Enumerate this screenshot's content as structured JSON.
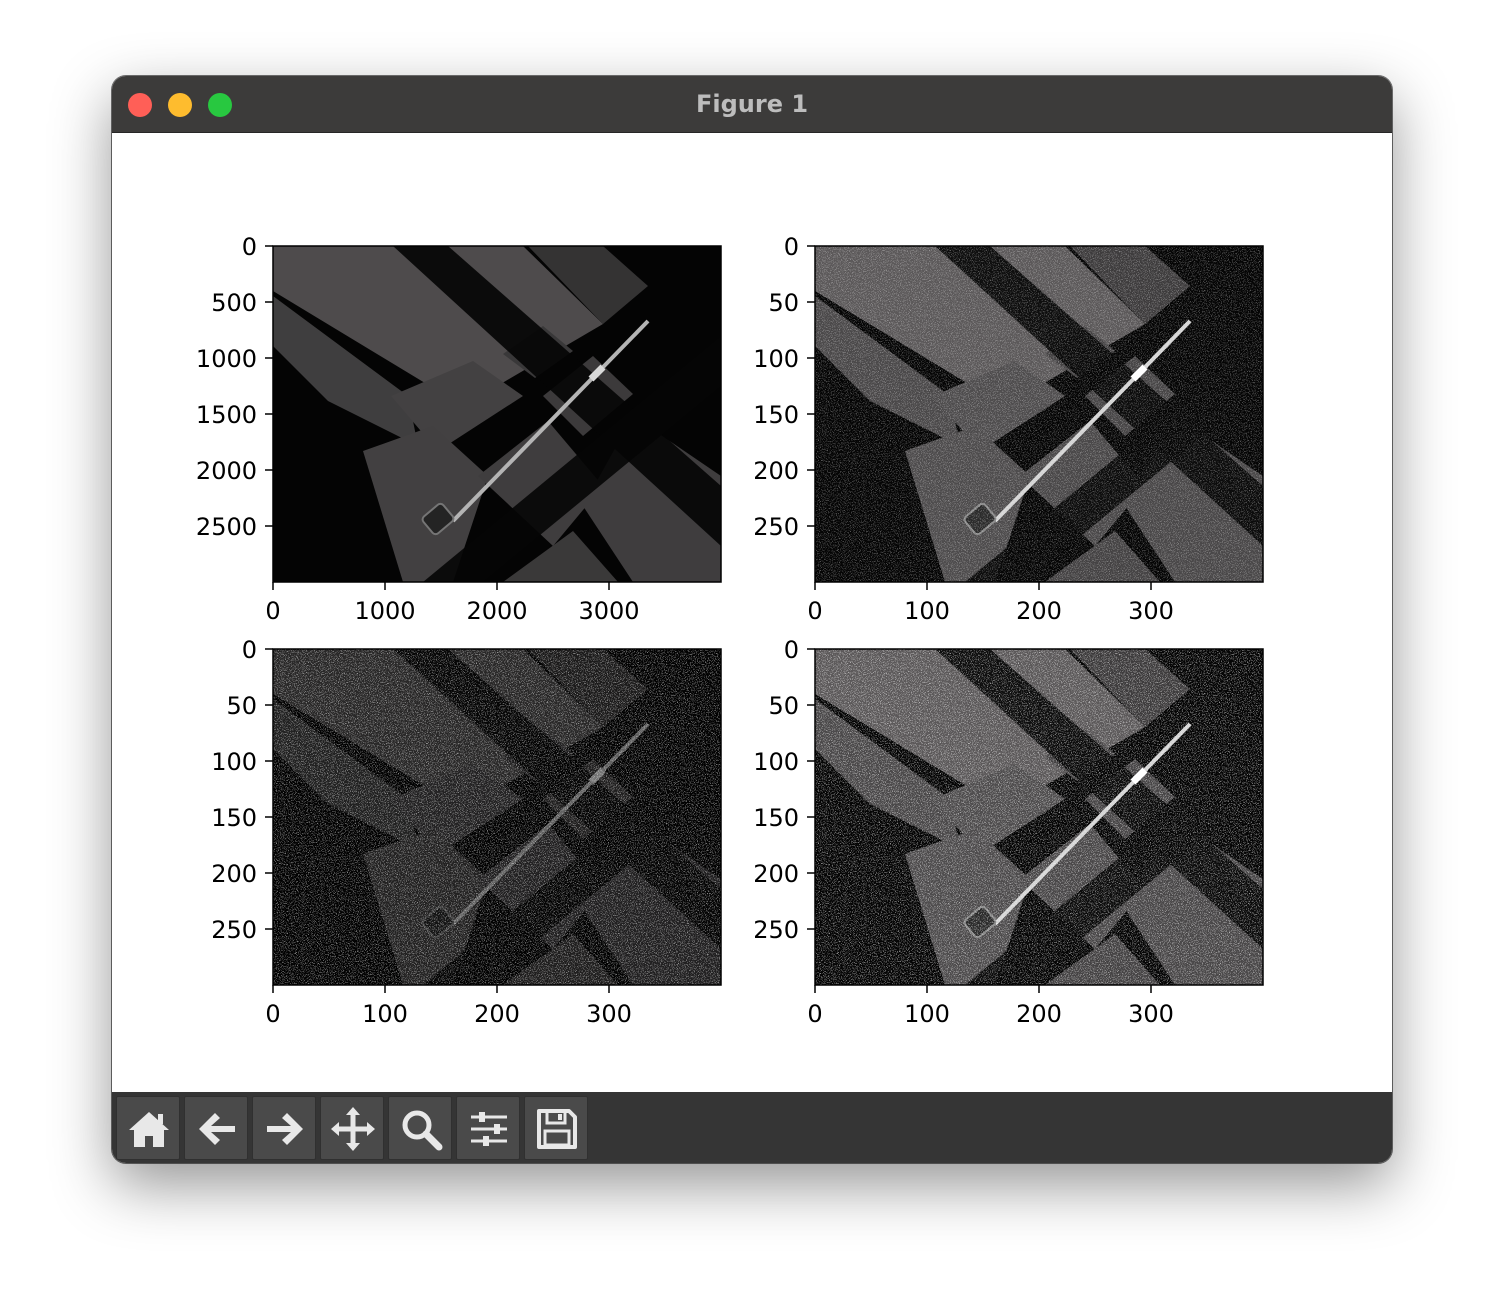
{
  "window": {
    "title": "Figure 1"
  },
  "toolbar": {
    "buttons": [
      {
        "name": "home-button",
        "icon": "home-icon"
      },
      {
        "name": "back-button",
        "icon": "arrow-left-icon"
      },
      {
        "name": "forward-button",
        "icon": "arrow-right-icon"
      },
      {
        "name": "pan-button",
        "icon": "move-icon"
      },
      {
        "name": "zoom-button",
        "icon": "magnifier-icon"
      },
      {
        "name": "configure-subplots-button",
        "icon": "sliders-icon"
      },
      {
        "name": "save-button",
        "icon": "floppy-disk-icon"
      }
    ]
  },
  "chart_data": [
    {
      "type": "image",
      "image_description": "grayscale photo of a barbell with weight plate on a gym floor with diagonal light and shadow",
      "xticks": [
        "0",
        "1000",
        "2000",
        "3000"
      ],
      "yticks": [
        "0",
        "500",
        "1000",
        "1500",
        "2000",
        "2500"
      ],
      "xlim": [
        0,
        4000
      ],
      "ylim": [
        3000,
        0
      ],
      "grid": false
    },
    {
      "type": "image",
      "image_description": "downsampled noisy version of the same barbell scene",
      "xticks": [
        "0",
        "100",
        "200",
        "300"
      ],
      "yticks": [
        "0",
        "50",
        "100",
        "150",
        "200",
        "250"
      ],
      "xlim": [
        0,
        400
      ],
      "ylim": [
        300,
        0
      ],
      "grid": false
    },
    {
      "type": "image",
      "image_description": "thresholded high-contrast noisy version of the barbell scene",
      "xticks": [
        "0",
        "100",
        "200",
        "300"
      ],
      "yticks": [
        "0",
        "50",
        "100",
        "150",
        "200",
        "250"
      ],
      "xlim": [
        0,
        400
      ],
      "ylim": [
        300,
        0
      ],
      "grid": false
    },
    {
      "type": "image",
      "image_description": "brighter noisy version of the barbell scene",
      "xticks": [
        "0",
        "100",
        "200",
        "300"
      ],
      "yticks": [
        "0",
        "50",
        "100",
        "150",
        "200",
        "250"
      ],
      "xlim": [
        0,
        400
      ],
      "ylim": [
        300,
        0
      ],
      "grid": false
    }
  ]
}
